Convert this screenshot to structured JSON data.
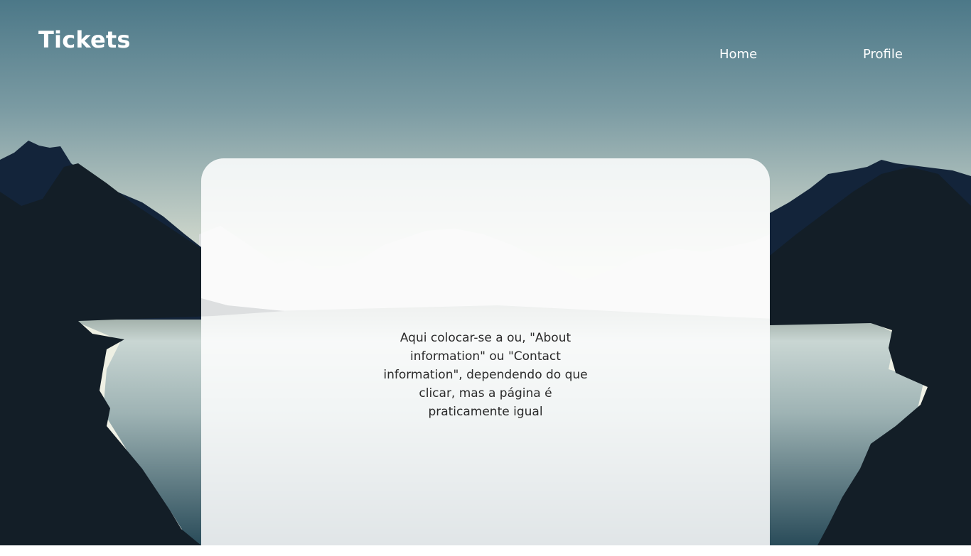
{
  "header": {
    "logo": "Tickets",
    "nav": {
      "home": "Home",
      "profile": "Profile"
    }
  },
  "card": {
    "text": "Aqui colocar-se a ou, \"About information\" ou \"Contact information\", dependendo do que clicar, mas a página é praticamente igual"
  },
  "colors": {
    "sky_top": "#4d7a8b",
    "sky_horizon": "#eef0e4",
    "mountain_dark": "#141e26",
    "mountain_navy": "#12243a",
    "lake_mid": "#c3d1cf",
    "lake_deep": "#2e4f5d",
    "card_bg": "#ffffff"
  }
}
